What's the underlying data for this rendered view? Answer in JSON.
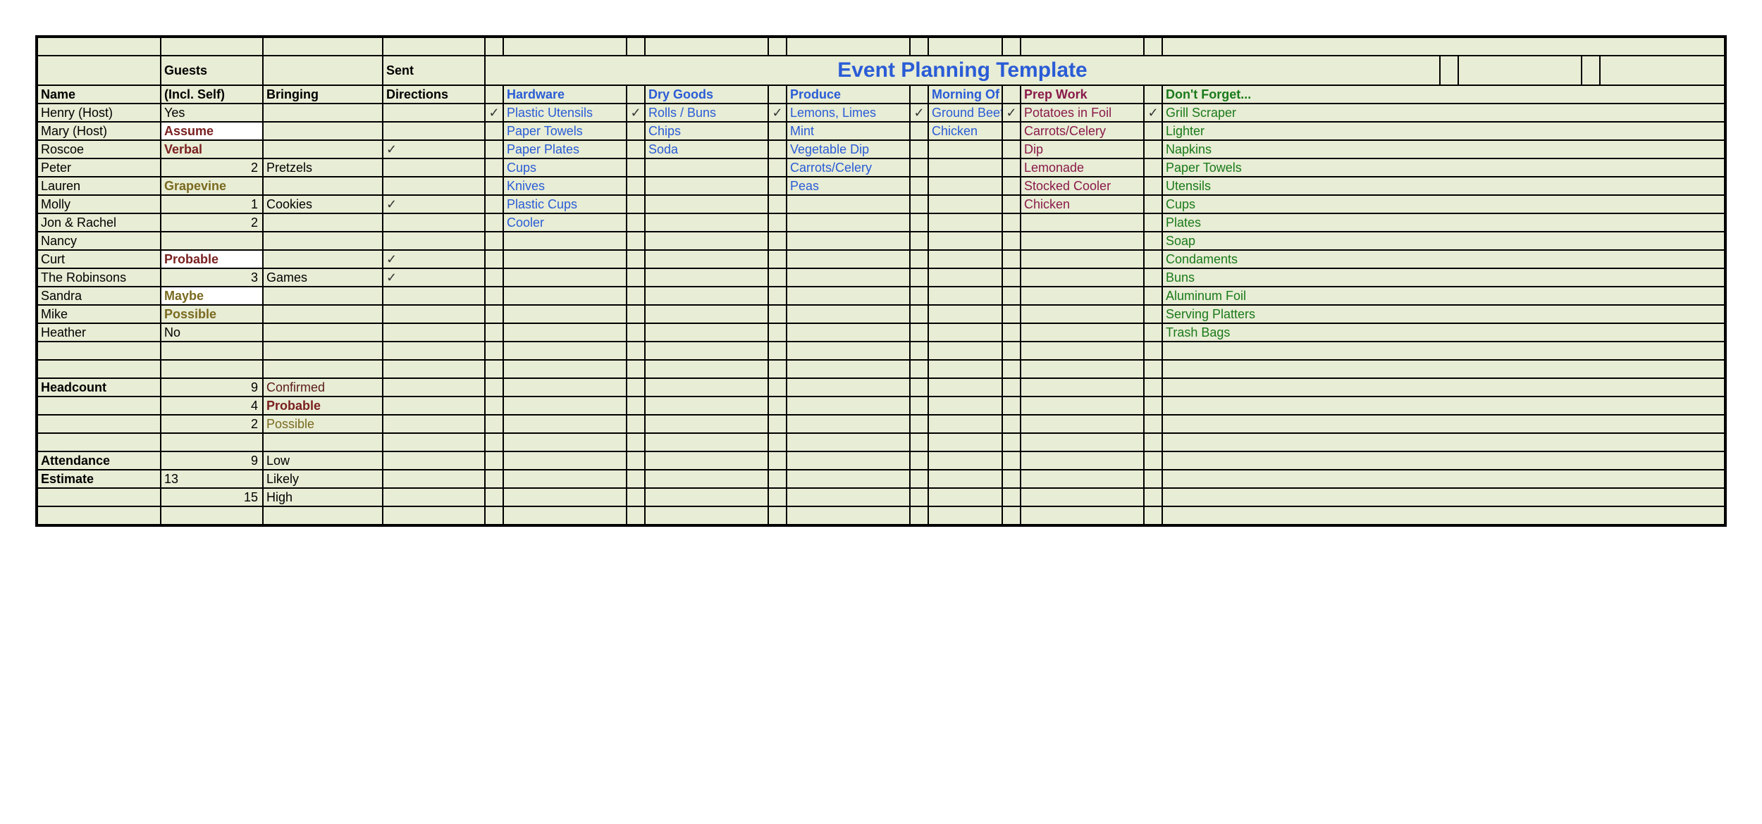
{
  "title": "Event Planning Template",
  "top_headers": {
    "guests": "Guests",
    "sent": "Sent"
  },
  "headers": {
    "name": "Name",
    "incl": "(Incl. Self)",
    "bring": "Bringing",
    "dir": "Directions",
    "hardware": "Hardware",
    "drygoods": "Dry Goods",
    "produce": "Produce",
    "morning": "Morning Of",
    "prep": "Prep Work",
    "forget": "Don't Forget..."
  },
  "guests": [
    {
      "name": "Henry (Host)",
      "incl": "Yes",
      "bring": "",
      "dir": ""
    },
    {
      "name": "Mary (Host)",
      "incl": "Assume",
      "inclCls": "txt-assume",
      "bring": "",
      "dir": ""
    },
    {
      "name": "Roscoe",
      "incl": "Verbal",
      "inclCls": "txt-verbal",
      "bring": "",
      "dir": "✓"
    },
    {
      "name": "Peter",
      "incl": "2",
      "inclNum": true,
      "bring": "Pretzels",
      "dir": ""
    },
    {
      "name": "Lauren",
      "incl": "Grapevine",
      "inclCls": "txt-grape",
      "bring": "",
      "dir": ""
    },
    {
      "name": "Molly",
      "incl": "1",
      "inclNum": true,
      "bring": "Cookies",
      "dir": "✓"
    },
    {
      "name": "Jon & Rachel",
      "incl": "2",
      "inclNum": true,
      "bring": "",
      "dir": ""
    },
    {
      "name": "Nancy",
      "incl": "",
      "bring": "",
      "dir": ""
    },
    {
      "name": "Curt",
      "incl": "Probable",
      "inclCls": "txt-prob",
      "bring": "",
      "dir": "✓"
    },
    {
      "name": "The Robinsons",
      "incl": "3",
      "inclNum": true,
      "bring": "Games",
      "dir": "✓"
    },
    {
      "name": "Sandra",
      "incl": "Maybe",
      "inclCls": "txt-maybe",
      "bring": "",
      "dir": ""
    },
    {
      "name": "Mike",
      "incl": "Possible",
      "inclCls": "txt-poss",
      "bring": "",
      "dir": ""
    },
    {
      "name": "Heather",
      "incl": "No",
      "bring": "",
      "dir": ""
    }
  ],
  "hardware": [
    {
      "chk": "✓",
      "item": "Plastic Utensils"
    },
    {
      "chk": "",
      "item": "Paper Towels"
    },
    {
      "chk": "",
      "item": "Paper Plates"
    },
    {
      "chk": "",
      "item": "Cups"
    },
    {
      "chk": "",
      "item": "Knives"
    },
    {
      "chk": "",
      "item": "Plastic Cups"
    },
    {
      "chk": "",
      "item": "Cooler"
    }
  ],
  "drygoods": [
    {
      "chk": "✓",
      "item": "Rolls / Buns"
    },
    {
      "chk": "",
      "item": "Chips"
    },
    {
      "chk": "",
      "item": "Soda"
    }
  ],
  "produce": [
    {
      "chk": "✓",
      "item": "Lemons, Limes"
    },
    {
      "chk": "",
      "item": "Mint"
    },
    {
      "chk": "",
      "item": "Vegetable Dip"
    },
    {
      "chk": "",
      "item": "Carrots/Celery"
    },
    {
      "chk": "",
      "item": "Peas"
    }
  ],
  "morning": [
    {
      "chk": "✓",
      "item": "Ground Beef"
    },
    {
      "chk": "",
      "item": "Chicken"
    }
  ],
  "prep": [
    {
      "chk": "✓",
      "item": "Potatoes in Foil"
    },
    {
      "chk": "",
      "item": "Carrots/Celery"
    },
    {
      "chk": "",
      "item": "Dip"
    },
    {
      "chk": "",
      "item": "Lemonade"
    },
    {
      "chk": "",
      "item": "Stocked Cooler"
    },
    {
      "chk": "",
      "item": "Chicken"
    }
  ],
  "forget": [
    {
      "chk": "✓",
      "item": "Grill Scraper"
    },
    {
      "chk": "",
      "item": "Lighter"
    },
    {
      "chk": "",
      "item": "Napkins"
    },
    {
      "chk": "",
      "item": "Paper Towels"
    },
    {
      "chk": "",
      "item": "Utensils"
    },
    {
      "chk": "",
      "item": "Cups"
    },
    {
      "chk": "",
      "item": "Plates"
    },
    {
      "chk": "",
      "item": "Soap"
    },
    {
      "chk": "",
      "item": "Condaments"
    },
    {
      "chk": "",
      "item": "Buns"
    },
    {
      "chk": "",
      "item": "Aluminum Foil"
    },
    {
      "chk": "",
      "item": "Serving Platters"
    },
    {
      "chk": "",
      "item": "Trash Bags"
    }
  ],
  "summary": {
    "headcount_label": "Headcount",
    "headcount": [
      {
        "n": "9",
        "label": "Confirmed",
        "cls": "txt-confC"
      },
      {
        "n": "4",
        "label": "Probable",
        "cls": "txt-probC"
      },
      {
        "n": "2",
        "label": "Possible",
        "cls": "txt-possC"
      }
    ],
    "attendance_label": "Attendance",
    "estimate_label": "Estimate",
    "attendance": [
      {
        "n": "9",
        "label": "Low"
      },
      {
        "n": "13",
        "label": "Likely"
      },
      {
        "n": "15",
        "label": "High"
      }
    ]
  }
}
